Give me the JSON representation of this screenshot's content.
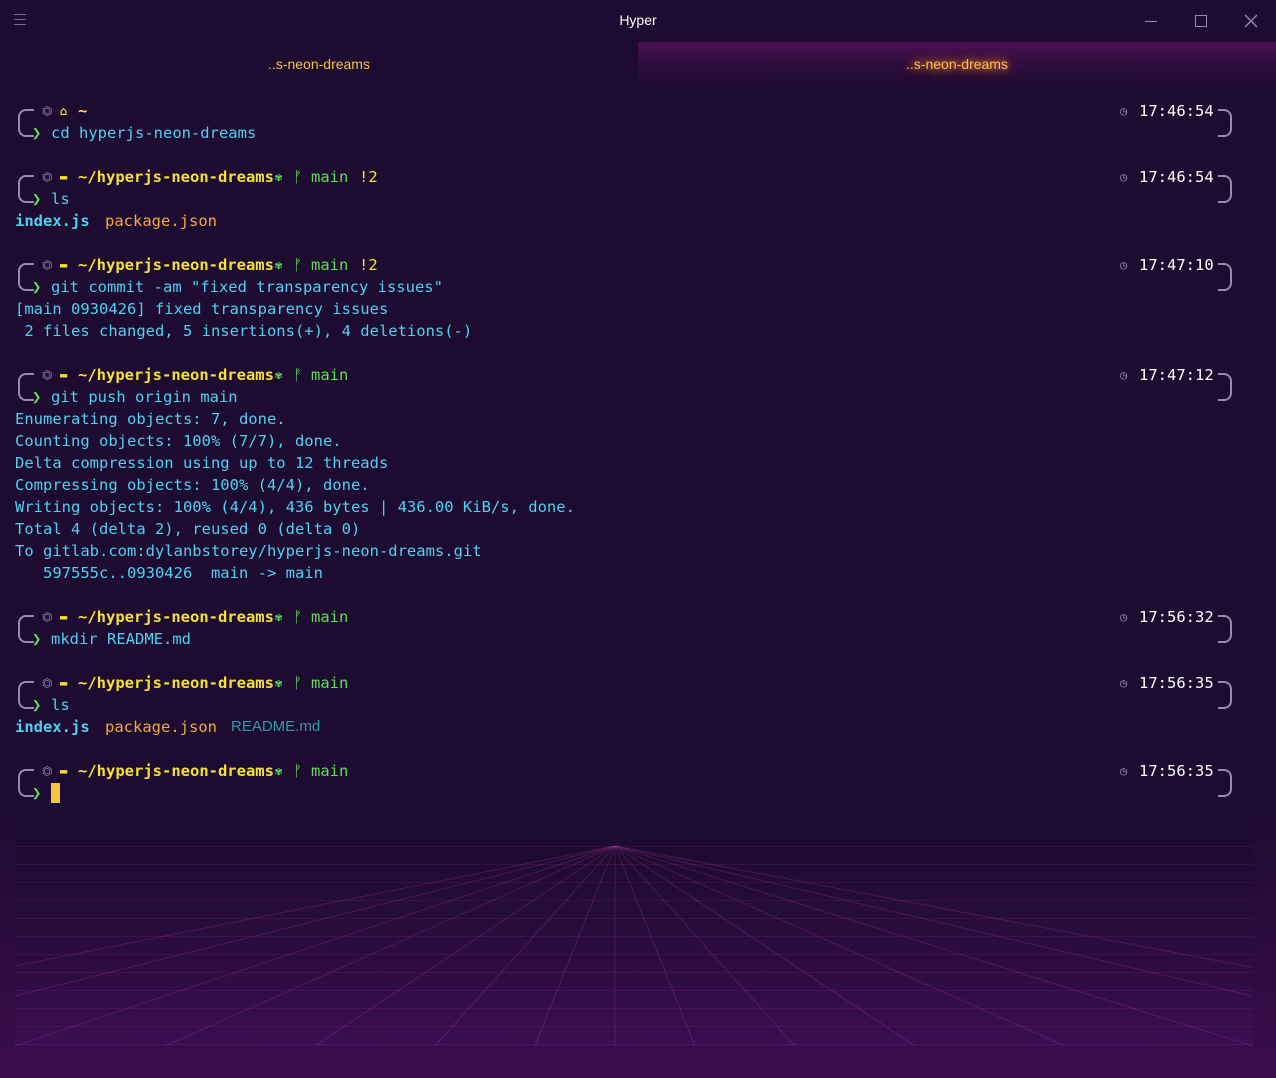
{
  "window": {
    "title": "Hyper",
    "tabs": [
      {
        "label": "..s-neon-dreams",
        "active": false
      },
      {
        "label": "..s-neon-dreams",
        "active": true
      }
    ]
  },
  "icons": {
    "menu": "hamburger-icon",
    "minimize": "minimize-icon",
    "maximize": "maximize-icon",
    "close": "close-icon",
    "os": "os-icon",
    "home": "home-icon",
    "folder": "folder-icon",
    "git": "git-icon",
    "branch": "branch-icon",
    "clock": "clock-icon"
  },
  "colors": {
    "background": "#1e0b31",
    "cyan": "#4dd2f0",
    "yellow": "#f5e230",
    "green": "#5de052",
    "orange": "#f5a83d",
    "tab_text": "#f5c33d",
    "cursor": "#f5c33d"
  },
  "prompts": [
    {
      "dir": "~",
      "home": true,
      "branch": "",
      "status": "",
      "time": "17:46:54",
      "command": "cd hyperjs-neon-dreams",
      "output": []
    },
    {
      "dir": "~/hyperjs-neon-dreams",
      "home": false,
      "branch": "main",
      "status": "!2",
      "time": "17:46:54",
      "command": "ls",
      "output": []
    },
    {
      "dir": "~/hyperjs-neon-dreams",
      "home": false,
      "branch": "main",
      "status": "!2",
      "time": "17:47:10",
      "command": "git commit -am \"fixed transparency issues\"",
      "output": [
        "[main 0930426] fixed transparency issues",
        " 2 files changed, 5 insertions(+), 4 deletions(-)"
      ]
    },
    {
      "dir": "~/hyperjs-neon-dreams",
      "home": false,
      "branch": "main",
      "status": "",
      "time": "17:47:12",
      "command": "git push origin main",
      "output": [
        "Enumerating objects: 7, done.",
        "Counting objects: 100% (7/7), done.",
        "Delta compression using up to 12 threads",
        "Compressing objects: 100% (4/4), done.",
        "Writing objects: 100% (4/4), 436 bytes | 436.00 KiB/s, done.",
        "Total 4 (delta 2), reused 0 (delta 0)",
        "To gitlab.com:dylanbstorey/hyperjs-neon-dreams.git",
        "   597555c..0930426  main -> main"
      ]
    },
    {
      "dir": "~/hyperjs-neon-dreams",
      "home": false,
      "branch": "main",
      "status": "",
      "time": "17:56:32",
      "command": "mkdir README.md",
      "output": []
    },
    {
      "dir": "~/hyperjs-neon-dreams",
      "home": false,
      "branch": "main",
      "status": "",
      "time": "17:56:35",
      "command": "ls",
      "output": []
    },
    {
      "dir": "~/hyperjs-neon-dreams",
      "home": false,
      "branch": "main",
      "status": "",
      "time": "17:56:35",
      "command": "",
      "output": []
    }
  ],
  "ls_output_1": {
    "file1": "index.js",
    "file2": "package.json"
  },
  "ls_output_2": {
    "file1": "index.js",
    "file2": "package.json",
    "file3": "README.md"
  }
}
